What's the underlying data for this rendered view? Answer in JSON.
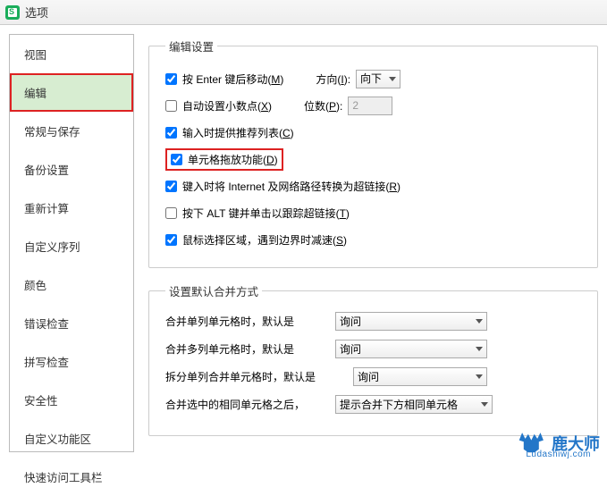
{
  "title": "选项",
  "sidebar": {
    "items": [
      {
        "label": "视图"
      },
      {
        "label": "编辑"
      },
      {
        "label": "常规与保存"
      },
      {
        "label": "备份设置"
      },
      {
        "label": "重新计算"
      },
      {
        "label": "自定义序列"
      },
      {
        "label": "颜色"
      },
      {
        "label": "错误检查"
      },
      {
        "label": "拼写检查"
      },
      {
        "label": "安全性"
      },
      {
        "label": "自定义功能区"
      },
      {
        "label": "快速访问工具栏"
      }
    ]
  },
  "edit_section": {
    "legend": "编辑设置",
    "opt_enter": {
      "label": "按 Enter 键后移动(",
      "key": "M",
      "tail": ")",
      "checked": true
    },
    "direction": {
      "label": "方向(",
      "key": "I",
      "tail": "):",
      "value": "向下"
    },
    "opt_decimal": {
      "label": "自动设置小数点(",
      "key": "X",
      "tail": ")",
      "checked": false
    },
    "places": {
      "label": "位数(",
      "key": "P",
      "tail": "):",
      "value": "2"
    },
    "opt_autocomplete": {
      "label": "输入时提供推荐列表(",
      "key": "C",
      "tail": ")",
      "checked": true
    },
    "opt_drag": {
      "label": "单元格拖放功能(",
      "key": "D",
      "tail": ")",
      "checked": true
    },
    "opt_hyperlink": {
      "label": "键入时将 Internet 及网络路径转换为超链接(",
      "key": "R",
      "tail": ")",
      "checked": true
    },
    "opt_alt": {
      "label": "按下 ALT 键并单击以跟踪超链接(",
      "key": "T",
      "tail": ")",
      "checked": false
    },
    "opt_slow": {
      "label": "鼠标选择区域，遇到边界时减速(",
      "key": "S",
      "tail": ")",
      "checked": true
    }
  },
  "merge_section": {
    "legend": "设置默认合并方式",
    "r1_label": "合并单列单元格时，默认是",
    "r1_value": "询问",
    "r2_label": "合并多列单元格时，默认是",
    "r2_value": "询问",
    "r3_label": "拆分单列合并单元格时，默认是",
    "r3_value": "询问",
    "r4_label": "合并选中的相同单元格之后，",
    "r4_value": "提示合并下方相同单元格"
  },
  "watermark": {
    "name": "鹿大师",
    "sub": "Ludashiwj.com"
  }
}
